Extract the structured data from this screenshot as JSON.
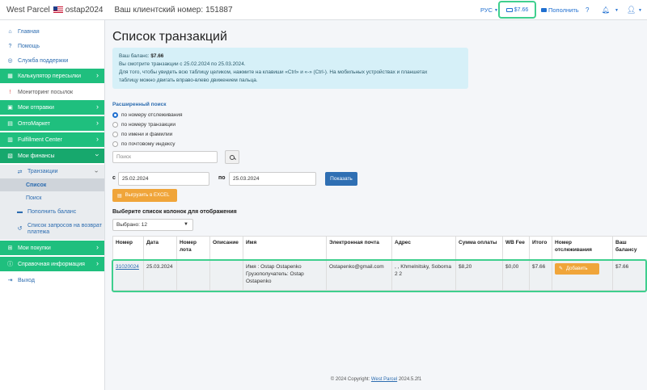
{
  "navbar": {
    "brand": "West Parcel",
    "user": "ostap2024",
    "client_label": "Ваш клиентский номер:",
    "client_number": "151887",
    "lang": "РУС",
    "balance": "$7.66",
    "topup": "Пополнить",
    "help": "?"
  },
  "sidebar": {
    "home": "Главная",
    "help": "Помощь",
    "support": "Служба поддержки",
    "calculator": "Калькулятор пересылки",
    "monitoring": "Мониторинг посылок",
    "shipments": "Мои отправки",
    "optomarket": "ОптоМаркет",
    "fulfillment": "Fulfillment Center",
    "finances": "Мои финансы",
    "transactions": "Транзакции",
    "list": "Список",
    "search": "Поиск",
    "topup": "Пополнить баланс",
    "refunds": "Список запросов на возврат платежа",
    "purchases": "Мои покупки",
    "reference": "Справочная информация",
    "logout": "Выход"
  },
  "main": {
    "title": "Список транзакций",
    "alert": {
      "balance_label": "Ваш баланс:",
      "balance": "$7.66",
      "period": "Вы смотрите транзакции с 25.02.2024 по 25.03.2024.",
      "hint1": "Для того, чтобы увидеть всю таблицу целиком, нажмите на клавиши «Ctrl» и «-» (Ctrl-). На мобильных устройствах и планшетах",
      "hint2": "таблицу можно двигать вправо-влево движением пальца."
    },
    "advanced_search": "Расширенный поиск",
    "radios": [
      "по номеру отслеживания",
      "по номеру транзакции",
      "по имени и фамилии",
      "по почтовому индексу"
    ],
    "search_placeholder": "Поиск",
    "from_label": "с",
    "from_date": "25.02.2024",
    "to_label": "по",
    "to_date": "25.03.2024",
    "show_button": "Показать",
    "excel_button": "Выгрузить в EXCEL",
    "columns_title": "Выберите список колонок для отображения",
    "columns_select": "Выбрано: 12"
  },
  "table": {
    "headers": [
      "Номер",
      "Дата",
      "Номер лота",
      "Описание",
      "Имя",
      "Электронная почта",
      "Адрес",
      "Сумма оплаты",
      "WB Fee",
      "Итого",
      "Номер отслеживания",
      "Ваш балансу"
    ],
    "row": {
      "number": "31020024",
      "date": "25.03.2024",
      "lot": "",
      "description": "",
      "name1": "Имя : Ostap Ostapenko",
      "name2": "Грузополучатель: Ostap Ostapenko",
      "email": "Ostapenko@gmail.com",
      "address": ", , Khmelnitsky, Soborna 2 2",
      "amount": "$8,20",
      "wb_fee": "$0,00",
      "total": "$7.66",
      "add_button": "Добавить",
      "balance": "$7.66"
    }
  },
  "footer": {
    "text": "© 2024 Copyright:",
    "link": "West Parcel",
    "version": "2024.5.2f1"
  }
}
